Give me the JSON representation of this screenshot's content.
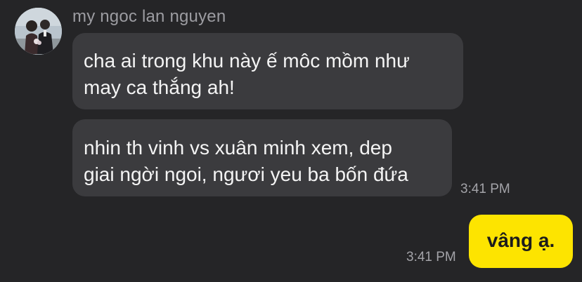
{
  "conversation": {
    "sender_name": "my ngoc lan nguyen",
    "messages": [
      {
        "direction": "incoming",
        "lines": [
          "cha ai trong khu này ế môc mồm như",
          "may ca thắng ah!"
        ],
        "time": ""
      },
      {
        "direction": "incoming",
        "lines": [
          "nhin th vinh vs xuân minh xem, dep",
          "giai ngời ngoi, ngươi yeu ba bốn đứa"
        ],
        "time": "3:41 PM"
      },
      {
        "direction": "outgoing",
        "lines": [
          "vâng ạ."
        ],
        "time": "3:41 PM"
      }
    ]
  },
  "colors": {
    "background": "#252527",
    "incoming_bubble": "#3b3b3e",
    "outgoing_bubble": "#fde400",
    "sender_name": "#9c9ca1",
    "timestamp": "#a3a3a8"
  }
}
